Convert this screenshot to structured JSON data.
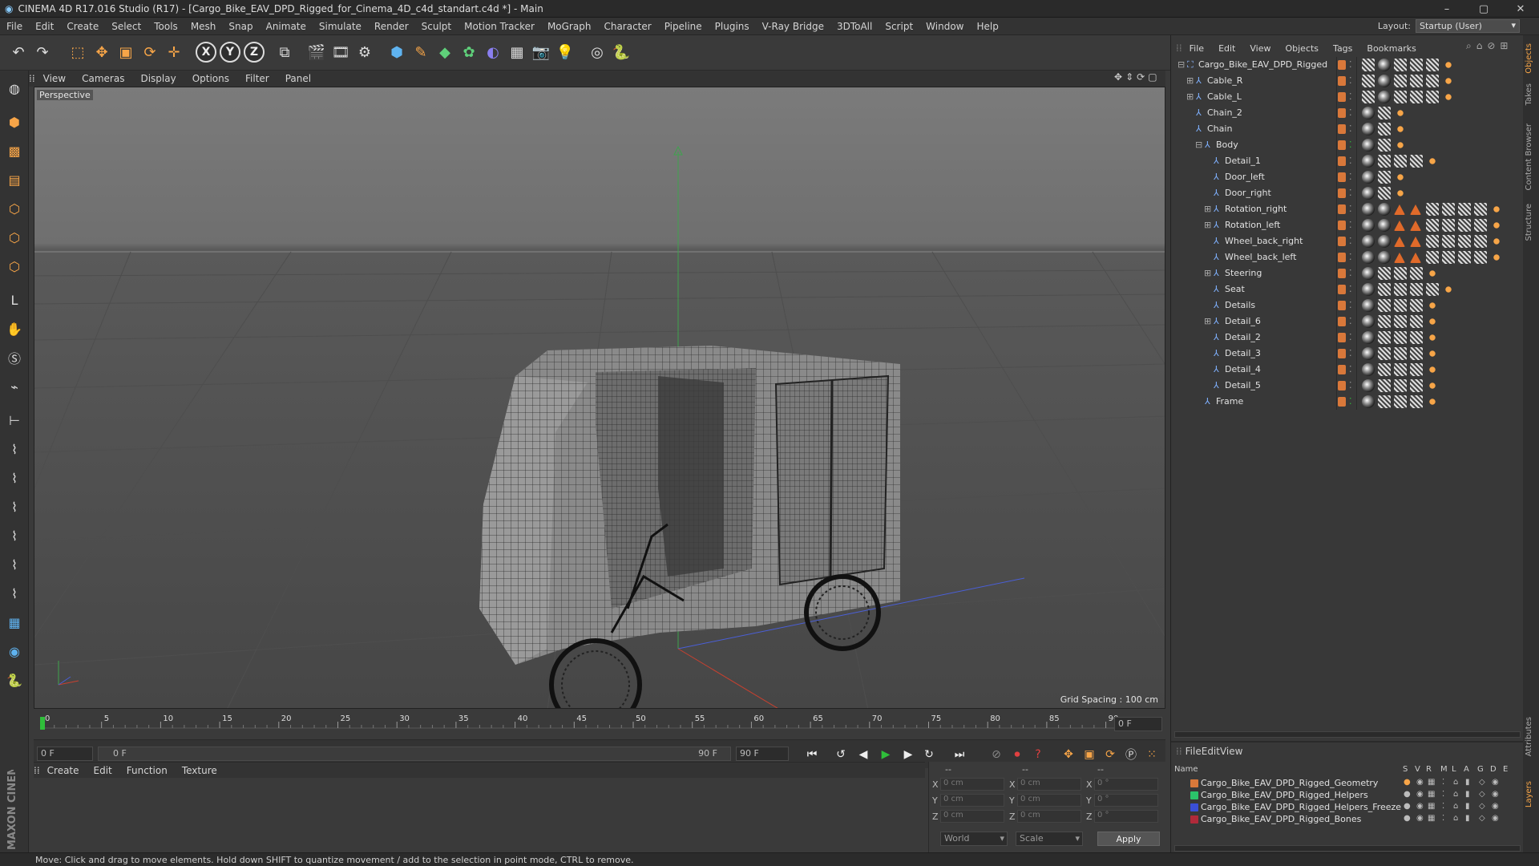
{
  "window": {
    "title": "CINEMA 4D R17.016 Studio (R17) - [Cargo_Bike_EAV_DPD_Rigged_for_Cinema_4D_c4d_standart.c4d *] - Main",
    "controls": [
      "–",
      "▢",
      "✕"
    ]
  },
  "menu": [
    "File",
    "Edit",
    "Create",
    "Select",
    "Tools",
    "Mesh",
    "Snap",
    "Animate",
    "Simulate",
    "Render",
    "Sculpt",
    "Motion Tracker",
    "MoGraph",
    "Character",
    "Pipeline",
    "Plugins",
    "V-Ray Bridge",
    "3DToAll",
    "Script",
    "Window",
    "Help"
  ],
  "layout": {
    "label": "Layout:",
    "value": "Startup (User)"
  },
  "toolbar": {
    "icons": [
      "undo-icon",
      "redo-icon",
      "live-selection-icon",
      "move-icon",
      "scale-icon",
      "rotate-icon",
      "move-plus-icon"
    ],
    "axes": [
      "X",
      "Y",
      "Z"
    ],
    "more_icons": [
      "coordinate-system-icon",
      "render-view-icon",
      "render-picture-viewer-icon",
      "render-settings-icon",
      "cube-icon",
      "spline-pen-icon",
      "nurbs-icon",
      "array-icon",
      "deformer-icon",
      "floor-icon",
      "camera-icon",
      "light-icon",
      "scene-icon",
      "python-icon"
    ]
  },
  "left_tools": [
    "make-editable-icon",
    "model-mode-icon",
    "texture-mode-icon",
    "workplane-icon",
    "points-mode-icon",
    "edges-mode-icon",
    "polygons-mode-icon",
    "axis-mode-icon",
    "brush-icon",
    "snap-icon",
    "magnet-icon",
    "axis-lock-icon",
    "bevel-icon",
    "knife-icon",
    "loop-icon",
    "extrude-icon",
    "bridge-icon",
    "weld-icon",
    "grid-icon",
    "sculpt-icon",
    "python-icon"
  ],
  "viewport": {
    "menu": [
      "View",
      "Cameras",
      "Display",
      "Options",
      "Filter",
      "Panel"
    ],
    "label": "Perspective",
    "grid_spacing": "Grid Spacing : 100 cm",
    "nav_icons": [
      "pan-icon",
      "move-view-icon",
      "rotate-view-icon",
      "maximize-icon"
    ]
  },
  "timeline": {
    "ticks": [
      "0",
      "5",
      "10",
      "15",
      "20",
      "25",
      "30",
      "35",
      "40",
      "45",
      "50",
      "55",
      "60",
      "65",
      "70",
      "75",
      "80",
      "85",
      "90"
    ],
    "current_frame": "0 F",
    "start_field": "0 F",
    "range_start": "0 F",
    "range_end": "90 F",
    "end_field": "90 F",
    "playhead_fraction": 0.0
  },
  "material_menu": [
    "Create",
    "Edit",
    "Function",
    "Texture"
  ],
  "coords": {
    "rows": [
      {
        "axis": "X",
        "pos": "0 cm",
        "axis2": "X",
        "size": "0 cm",
        "axis3": "X",
        "rot": "0 °"
      },
      {
        "axis": "Y",
        "pos": "0 cm",
        "axis2": "Y",
        "size": "0 cm",
        "axis3": "Y",
        "rot": "0 °"
      },
      {
        "axis": "Z",
        "pos": "0 cm",
        "axis2": "Z",
        "size": "0 cm",
        "axis3": "Z",
        "rot": "0 °"
      }
    ],
    "headers": [
      "--",
      "--",
      "--"
    ],
    "mode": "World",
    "transform": "Scale",
    "apply": "Apply"
  },
  "status": "Move: Click and drag to move elements. Hold down SHIFT to quantize movement / add to the selection in point mode, CTRL to remove.",
  "brand": "MAXON CINEMA 4D",
  "objects": {
    "menu": [
      "File",
      "Edit",
      "View",
      "Objects",
      "Tags",
      "Bookmarks"
    ],
    "items": [
      {
        "name": "Cargo_Bike_EAV_DPD_Rigged",
        "depth": 0,
        "expander": "⊟",
        "tags": [
          "chk",
          "sph",
          "chk",
          "chk",
          "chk",
          "org"
        ]
      },
      {
        "name": "Cable_R",
        "depth": 1,
        "expander": "⊞",
        "tags": [
          "chk",
          "sph",
          "chk",
          "chk",
          "chk",
          "org"
        ]
      },
      {
        "name": "Cable_L",
        "depth": 1,
        "expander": "⊞",
        "tags": [
          "chk",
          "sph",
          "chk",
          "chk",
          "chk",
          "org"
        ]
      },
      {
        "name": "Chain_2",
        "depth": 1,
        "expander": "",
        "tags": [
          "sph",
          "chk",
          "org"
        ]
      },
      {
        "name": "Chain",
        "depth": 1,
        "expander": "",
        "tags": [
          "sph",
          "chk",
          "org"
        ]
      },
      {
        "name": "Body",
        "depth": 2,
        "expander": "⊟",
        "tags": [
          "sph",
          "chk",
          "org"
        ]
      },
      {
        "name": "Detail_1",
        "depth": 3,
        "expander": "",
        "tags": [
          "sph",
          "chk",
          "chk",
          "chk",
          "org"
        ]
      },
      {
        "name": "Door_left",
        "depth": 3,
        "expander": "",
        "tags": [
          "sph",
          "chk",
          "org"
        ]
      },
      {
        "name": "Door_right",
        "depth": 3,
        "expander": "",
        "tags": [
          "sph",
          "chk",
          "org"
        ]
      },
      {
        "name": "Rotation_right",
        "depth": 3,
        "expander": "⊞",
        "tags": [
          "sph",
          "sph",
          "tri",
          "tri",
          "chk",
          "chk",
          "chk",
          "chk",
          "org"
        ]
      },
      {
        "name": "Rotation_left",
        "depth": 3,
        "expander": "⊞",
        "tags": [
          "sph",
          "sph",
          "tri",
          "tri",
          "chk",
          "chk",
          "chk",
          "chk",
          "org"
        ]
      },
      {
        "name": "Wheel_back_right",
        "depth": 3,
        "expander": "",
        "tags": [
          "sph",
          "sph",
          "tri",
          "tri",
          "chk",
          "chk",
          "chk",
          "chk",
          "org"
        ]
      },
      {
        "name": "Wheel_back_left",
        "depth": 3,
        "expander": "",
        "tags": [
          "sph",
          "sph",
          "tri",
          "tri",
          "chk",
          "chk",
          "chk",
          "chk",
          "org"
        ]
      },
      {
        "name": "Steering",
        "depth": 3,
        "expander": "⊞",
        "tags": [
          "sph",
          "chk",
          "chk",
          "chk",
          "org"
        ]
      },
      {
        "name": "Seat",
        "depth": 3,
        "expander": "",
        "tags": [
          "sph",
          "chk",
          "chk",
          "chk",
          "chk",
          "org"
        ]
      },
      {
        "name": "Details",
        "depth": 3,
        "expander": "",
        "tags": [
          "sph",
          "chk",
          "chk",
          "chk",
          "org"
        ]
      },
      {
        "name": "Detail_6",
        "depth": 3,
        "expander": "⊞",
        "tags": [
          "sph",
          "chk",
          "chk",
          "chk",
          "org"
        ]
      },
      {
        "name": "Detail_2",
        "depth": 3,
        "expander": "",
        "tags": [
          "sph",
          "chk",
          "chk",
          "chk",
          "org"
        ]
      },
      {
        "name": "Detail_3",
        "depth": 3,
        "expander": "",
        "tags": [
          "sph",
          "chk",
          "chk",
          "chk",
          "org"
        ]
      },
      {
        "name": "Detail_4",
        "depth": 3,
        "expander": "",
        "tags": [
          "sph",
          "chk",
          "chk",
          "chk",
          "org"
        ]
      },
      {
        "name": "Detail_5",
        "depth": 3,
        "expander": "",
        "tags": [
          "sph",
          "chk",
          "chk",
          "chk",
          "org"
        ]
      },
      {
        "name": "Frame",
        "depth": 2,
        "expander": "",
        "tags": [
          "sph",
          "chk",
          "chk",
          "chk",
          "org"
        ]
      }
    ]
  },
  "side_tabs": [
    "Objects",
    "Takes",
    "Content Browser",
    "Structure",
    "Attributes",
    "Layers"
  ],
  "layers": {
    "menu": [
      "File",
      "Edit",
      "View"
    ],
    "headers": [
      "Name",
      "S",
      "V",
      "R",
      "M",
      "L",
      "A",
      "G",
      "D",
      "E"
    ],
    "items": [
      {
        "name": "Cargo_Bike_EAV_DPD_Rigged_Geometry",
        "color": "#d9783a"
      },
      {
        "name": "Cargo_Bike_EAV_DPD_Rigged_Helpers",
        "color": "#2bc46a"
      },
      {
        "name": "Cargo_Bike_EAV_DPD_Rigged_Helpers_Freeze",
        "color": "#3a4fd6"
      },
      {
        "name": "Cargo_Bike_EAV_DPD_Rigged_Bones",
        "color": "#b02a3a"
      }
    ]
  },
  "colors": {
    "accent": "#d9783a",
    "axis_green": "#3fa34d",
    "axis_blue": "#4a5fd8",
    "axis_red": "#c8402f"
  }
}
